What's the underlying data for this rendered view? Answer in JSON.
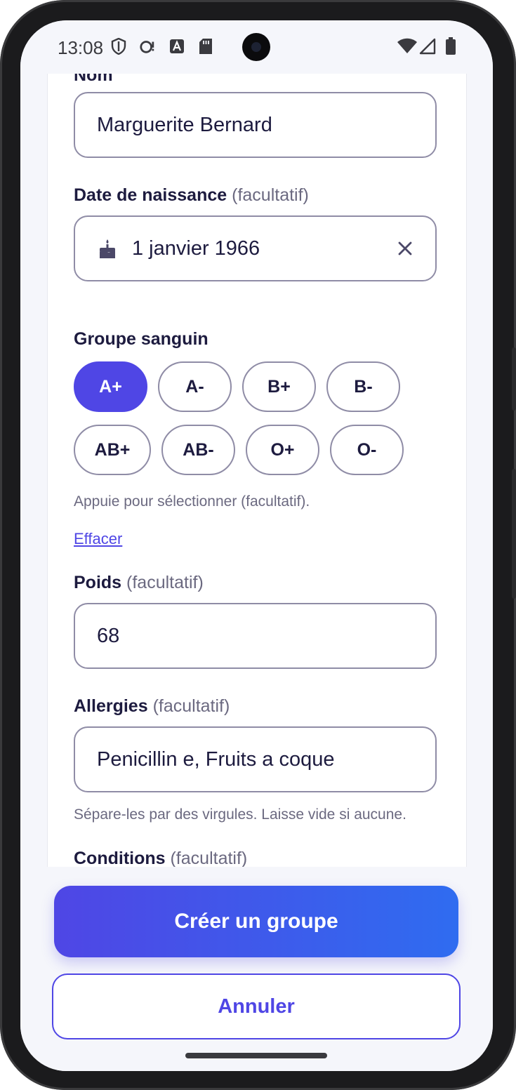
{
  "status_bar": {
    "time": "13:08",
    "icons": [
      "shield-icon",
      "sync-alert-icon",
      "a-badge-icon",
      "sd-card-icon"
    ],
    "right_icons": [
      "wifi-icon",
      "signal-icon",
      "battery-icon"
    ]
  },
  "form": {
    "name_label": "Nom",
    "name_value": "Marguerite Bernard",
    "dob_label": "Date de naissance",
    "dob_optional": "(facultatif)",
    "dob_value": "1 janvier 1966",
    "blood_label": "Groupe sanguin",
    "blood_groups": [
      "A+",
      "A-",
      "B+",
      "B-",
      "AB+",
      "AB-",
      "O+",
      "O-"
    ],
    "blood_selected": "A+",
    "blood_help": "Appuie pour sélectionner (facultatif).",
    "clear_link": "Effacer",
    "weight_label": "Poids",
    "weight_optional": "(facultatif)",
    "weight_value": "68",
    "allergies_label": "Allergies",
    "allergies_optional": "(facultatif)",
    "allergies_value": "Penicillin e, Fruits a coque",
    "allergies_help": "Sépare-les par des virgules. Laisse vide si aucune.",
    "conditions_label": "Conditions",
    "conditions_optional": "(facultatif)"
  },
  "actions": {
    "primary": "Créer un groupe",
    "secondary": "Annuler"
  },
  "colors": {
    "accent": "#4f46e5",
    "accent_end": "#2f6cf0",
    "text": "#1d1b3f",
    "muted": "#6b6980",
    "border": "#8f8ca6"
  }
}
